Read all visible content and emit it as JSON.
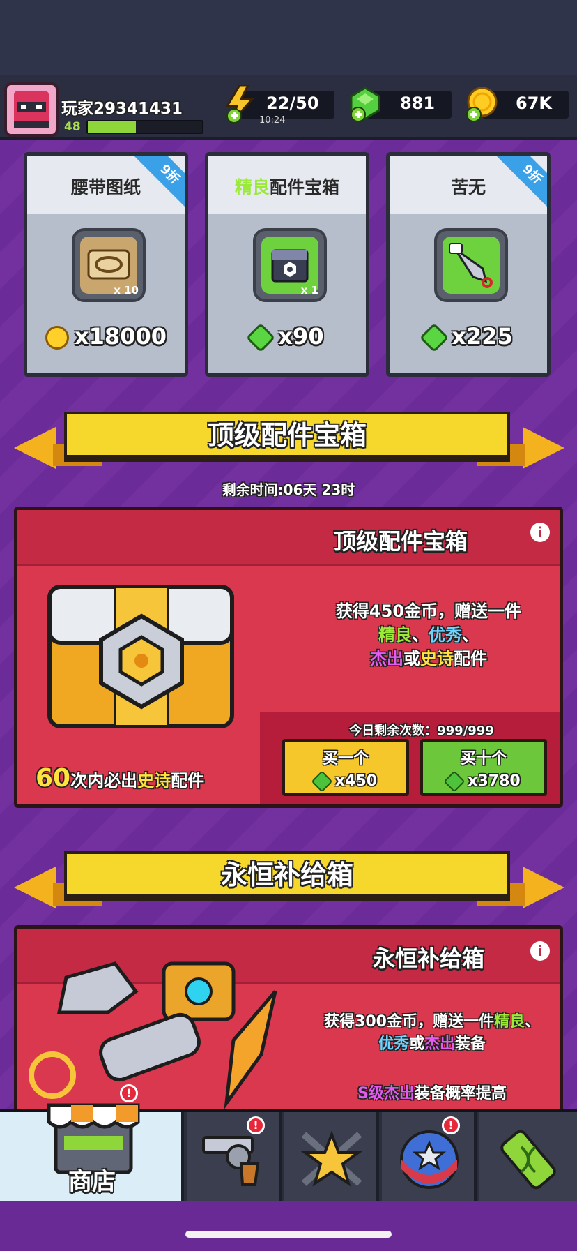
{
  "header": {
    "player_name": "玩家29341431",
    "level": "48",
    "xp_fraction": 0.42,
    "energy": "22/50",
    "energy_timer": "10:24",
    "gems": "881",
    "coins": "67K"
  },
  "deals": [
    {
      "title": "腰带图纸",
      "discount": "9折",
      "qty": "x 10",
      "price": "x18000",
      "currency": "coin",
      "icon": "belt-scroll-icon"
    },
    {
      "title_rarity": "精良",
      "title_rest": "配件宝箱",
      "discount": "",
      "qty": "x 1",
      "price": "x90",
      "currency": "gem",
      "icon": "chest-icon"
    },
    {
      "title": "苦无",
      "discount": "9折",
      "qty": "",
      "price": "x225",
      "currency": "gem",
      "icon": "kunai-icon"
    }
  ],
  "top_chest": {
    "banner": "顶级配件宝箱",
    "time_remaining": "剩余时间:06天 23时",
    "title": "顶级配件宝箱",
    "desc_line1": "获得450金币，赠送一件",
    "desc_r1": "精良",
    "desc_sep1": "、",
    "desc_r2": "优秀",
    "desc_sep2": "、",
    "desc_r3": "杰出",
    "desc_or": "或",
    "desc_r4": "史诗",
    "desc_tail": "配件",
    "daily_remaining": "今日剩余次数：999/999",
    "pity_num": "60",
    "pity_a": "次内必出",
    "pity_r": "史诗",
    "pity_b": "配件",
    "buy_one_label": "买一个",
    "buy_one_price": "x450",
    "buy_ten_label": "买十个",
    "buy_ten_price": "x3780"
  },
  "supply": {
    "banner": "永恒补给箱",
    "title": "永恒补给箱",
    "desc_a": "获得300金币，赠送一件",
    "desc_r1": "精良",
    "desc_sep": "、",
    "desc_r2": "优秀",
    "desc_or": "或",
    "desc_r3": "杰出",
    "desc_tail": "装备",
    "note_r": "S级杰出",
    "note_rest": "装备概率提高"
  },
  "nav": {
    "shop_label": "商店"
  },
  "colors": {
    "rarity_good": "#9bea3a",
    "rarity_excellent": "#6fd3ff",
    "rarity_outstanding": "#e25cf0",
    "rarity_epic": "#ffe23b"
  }
}
